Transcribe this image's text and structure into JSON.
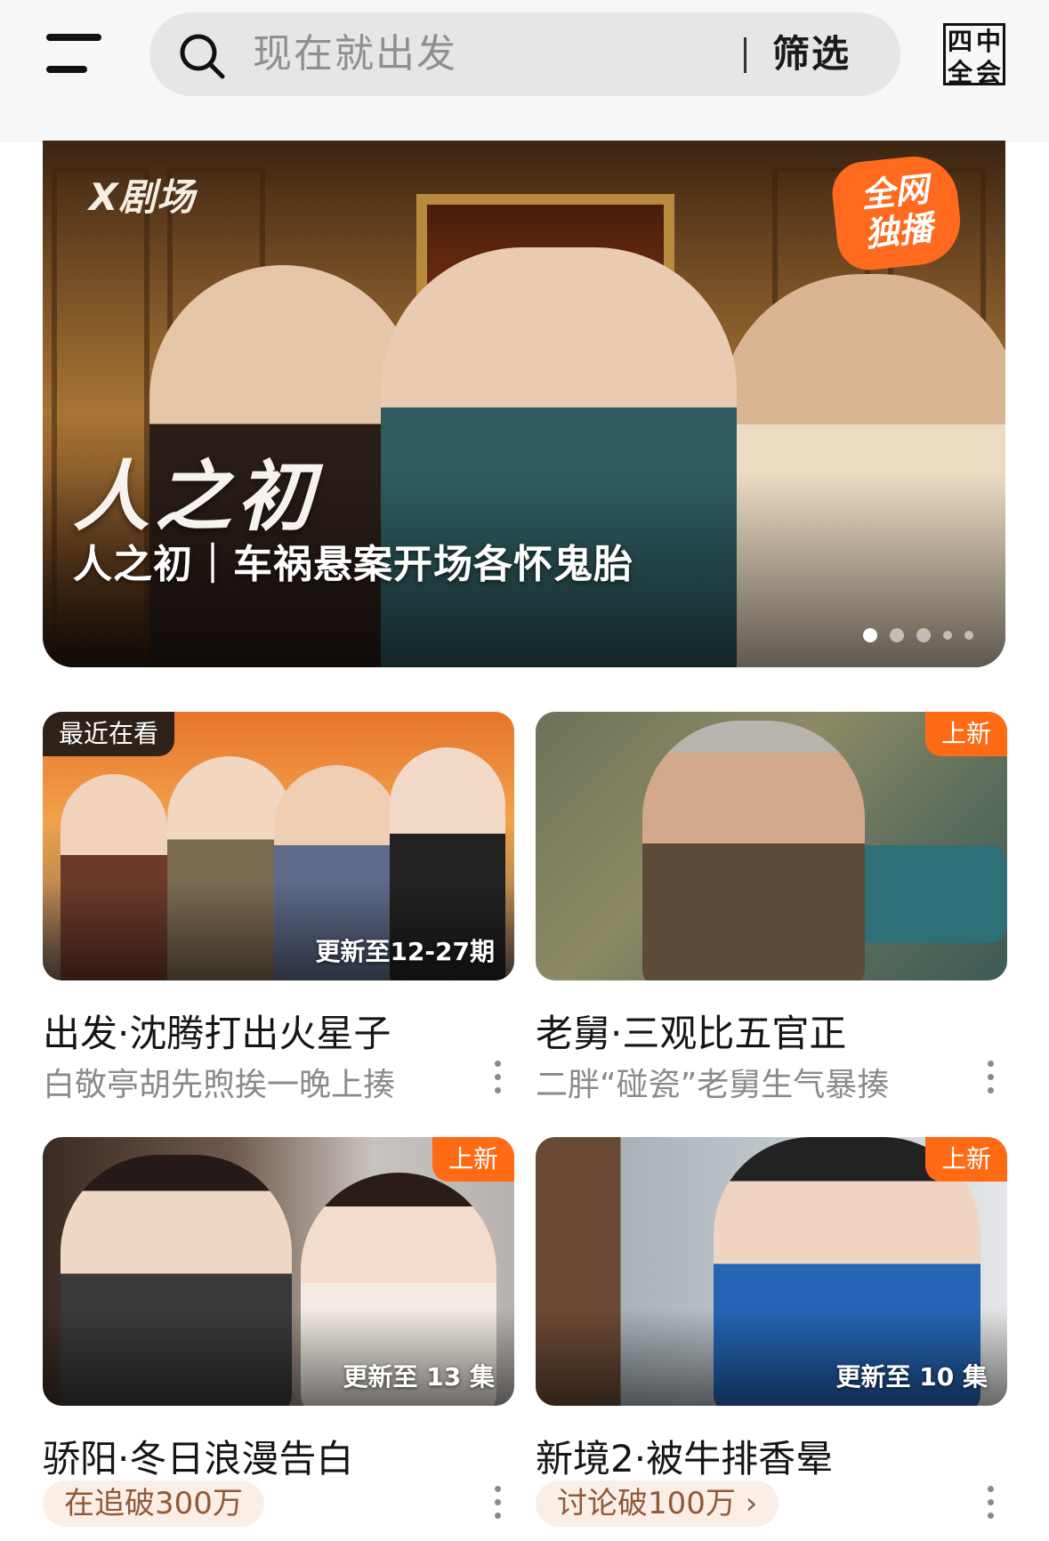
{
  "header": {
    "search_placeholder": "现在就出发",
    "filter_label": "筛选",
    "badge_chars": [
      "四",
      "中",
      "全",
      "会"
    ]
  },
  "hero": {
    "brand": "X剧场",
    "exclusive_badge": [
      "全网",
      "独播"
    ],
    "logo_title": "人之初",
    "caption": "人之初｜车祸悬案开场各怀鬼胎",
    "dots_count": 5,
    "active_dot": 0
  },
  "cards": [
    {
      "corner_tag": "最近在看",
      "corner_tag_type": "recent",
      "episode_label": "更新至12-27期",
      "title": "出发·沈腾打出火星子",
      "subtitle": "白敬亭胡先煦挨一晚上揍",
      "subtitle_type": "text"
    },
    {
      "corner_tag": "上新",
      "corner_tag_type": "new",
      "episode_label": "",
      "title": "老舅·三观比五官正",
      "subtitle": "二胖“碰瓷”老舅生气暴揍",
      "subtitle_type": "text"
    },
    {
      "corner_tag": "上新",
      "corner_tag_type": "new",
      "episode_label": "更新至 13 集",
      "title": "骄阳·冬日浪漫告白",
      "subtitle": "在追破300万",
      "subtitle_type": "chip"
    },
    {
      "corner_tag": "上新",
      "corner_tag_type": "new",
      "episode_label": "更新至 10 集",
      "title": "新境2·被牛排香晕",
      "subtitle": "讨论破100万 ›",
      "subtitle_type": "chip"
    }
  ],
  "colors": {
    "accent_orange": "#ff6a14",
    "chip_bg": "#fbeee6",
    "chip_text": "#8e5a3c",
    "muted_text": "#8a8a8a"
  }
}
